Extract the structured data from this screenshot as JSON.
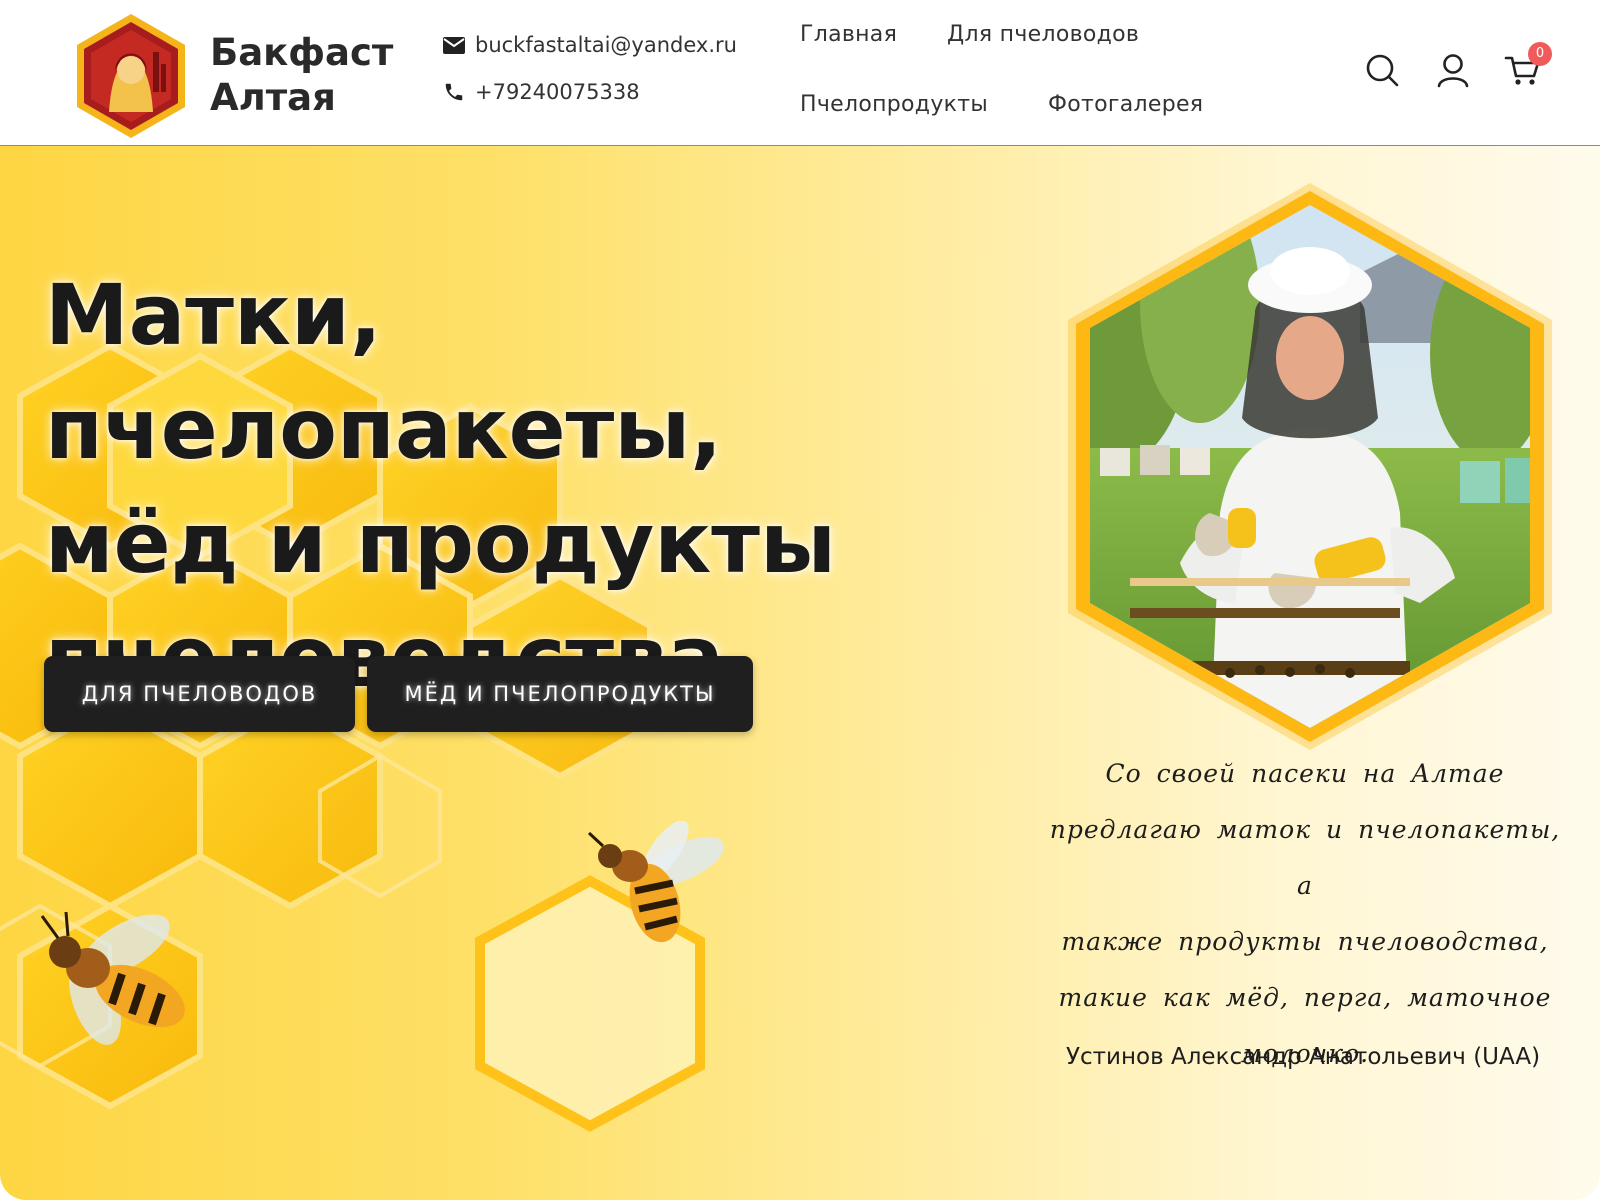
{
  "brand": {
    "line1": "Бакфаст",
    "line2": "Алтая"
  },
  "contacts": {
    "email": "buckfastaltai@yandex.ru",
    "phone": "+79240075338"
  },
  "nav": [
    "Главная",
    "Для пчеловодов",
    "Пчелопродукты",
    "Фотогалерея"
  ],
  "header_icons": [
    "search-icon",
    "user-icon",
    "cart-icon"
  ],
  "cart": {
    "count": "0"
  },
  "hero": {
    "title_lines": [
      "Матки, пчелопакеты,",
      "мёд и продукты",
      "пчеловодства"
    ],
    "buttons": [
      "ДЛЯ ПЧЕЛОВОДОВ",
      "МЁД И ПЧЕЛОПРОДУКТЫ"
    ],
    "quote_lines": [
      "Со своей пасеки на Алтае",
      "предлагаю маток и пчелопакеты, а",
      "также продукты пчеловодства,",
      "такие как мёд, перга, маточное",
      "молочко."
    ],
    "author": "Устинов Александр Анатольевич (UAA)"
  },
  "colors": {
    "accent": "#fdb813",
    "button_bg": "#1f1f1f",
    "badge": "#f15a5a",
    "logo_red": "#b51f1f"
  }
}
